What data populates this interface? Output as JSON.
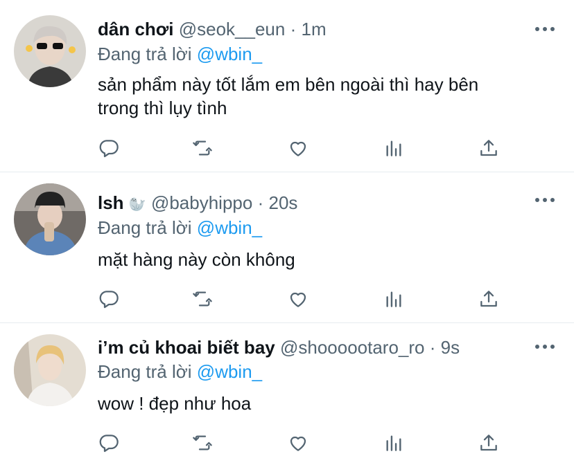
{
  "tweets": [
    {
      "name": "dân chơi",
      "name_badge": "",
      "handle": "@seok__eun",
      "time": "1m",
      "separator": "·",
      "reply_prefix": "Đang trả lời",
      "reply_to": "@wbin_",
      "text_lines": [
        "sản phẩm này tốt lắm em bên ngoài thì hay bên",
        "trong thì lụy tình"
      ]
    },
    {
      "name": "lsh",
      "name_badge": "🦭",
      "handle": "@babyhippo",
      "time": "20s",
      "separator": "·",
      "reply_prefix": "Đang trả lời",
      "reply_to": "@wbin_",
      "text_lines": [
        "mặt hàng này còn không"
      ]
    },
    {
      "name": "i’m củ khoai biết bay",
      "name_badge": "",
      "handle": "@shoooootaro_ro",
      "time": "9s",
      "separator": "·",
      "reply_prefix": "Đang trả lời",
      "reply_to": "@wbin_",
      "text_lines": [
        "wow ! đẹp như hoa"
      ]
    }
  ],
  "icons": {
    "reply": "speech-bubble-icon",
    "retweet": "retweet-icon",
    "like": "heart-icon",
    "analytics": "bar-chart-icon",
    "share": "share-upload-icon",
    "more": "more-dots-icon"
  },
  "colors": {
    "mention": "#1d9bf0",
    "secondary_text": "#536471",
    "divider": "#e6ecf0"
  }
}
